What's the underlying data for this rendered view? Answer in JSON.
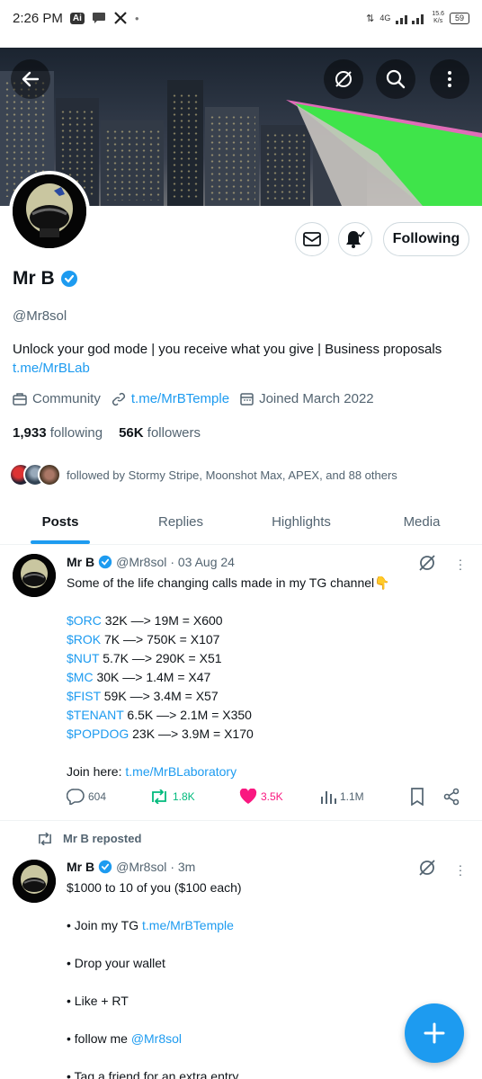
{
  "status_bar": {
    "time": "2:26 PM",
    "ai_badge": "Ai",
    "network": "4G",
    "speed_value": "15.6",
    "speed_unit": "K/s",
    "battery": "59"
  },
  "profile": {
    "name": "Mr B",
    "handle": "@Mr8sol",
    "bio_text": "Unlock your god mode | you receive what you give | Business proposals",
    "bio_link": "t.me/MrBLab",
    "community_label": "Community",
    "website": "t.me/MrBTemple",
    "joined": "Joined March 2022",
    "following_count": "1,933",
    "following_label": "following",
    "followers_count": "56K",
    "followers_label": "followers",
    "followed_by": "followed by Stormy Stripe, Moonshot Max, APEX, and 88 others",
    "following_button": "Following"
  },
  "tabs": [
    {
      "label": "Posts"
    },
    {
      "label": "Replies"
    },
    {
      "label": "Highlights"
    },
    {
      "label": "Media"
    }
  ],
  "post1": {
    "name": "Mr B",
    "handle": "@Mr8sol",
    "time": "· 03 Aug 24",
    "intro": "Some of the life changing calls made in my TG channel👇",
    "calls": [
      {
        "ticker": "$ORC",
        "rest": " 32K —> 19M = X600"
      },
      {
        "ticker": "$ROK",
        "rest": " 7K —> 750K = X107"
      },
      {
        "ticker": "$NUT",
        "rest": " 5.7K —> 290K = X51"
      },
      {
        "ticker": "$MC",
        "rest": " 30K —> 1.4M = X47"
      },
      {
        "ticker": "$FIST",
        "rest": " 59K —> 3.4M = X57"
      },
      {
        "ticker": "$TENANT",
        "rest": " 6.5K —> 2.1M = X350"
      },
      {
        "ticker": "$POPDOG",
        "rest": " 23K —> 3.9M = X170"
      }
    ],
    "join_text": "Join here: ",
    "join_link": "t.me/MrBLaboratory",
    "replies": "604",
    "reposts": "1.8K",
    "likes": "3.5K",
    "views": "1.1M"
  },
  "repost_note": "Mr B reposted",
  "post2": {
    "name": "Mr B",
    "handle": "@Mr8sol",
    "time": "· 3m",
    "line1": "$1000 to 10 of you ($100 each)",
    "line2_text": "• Join my TG ",
    "line2_link": "t.me/MrBTemple",
    "line3": "• Drop your wallet",
    "line4": "• Like + RT",
    "line5_text": "• follow me ",
    "line5_link": "@Mr8sol",
    "line6": "• Tag a friend for an extra entry"
  },
  "colors": {
    "accent": "#1d9bf0",
    "like": "#f91880",
    "repost": "#00ba7c",
    "text": "#0f1419",
    "muted": "#536471"
  }
}
